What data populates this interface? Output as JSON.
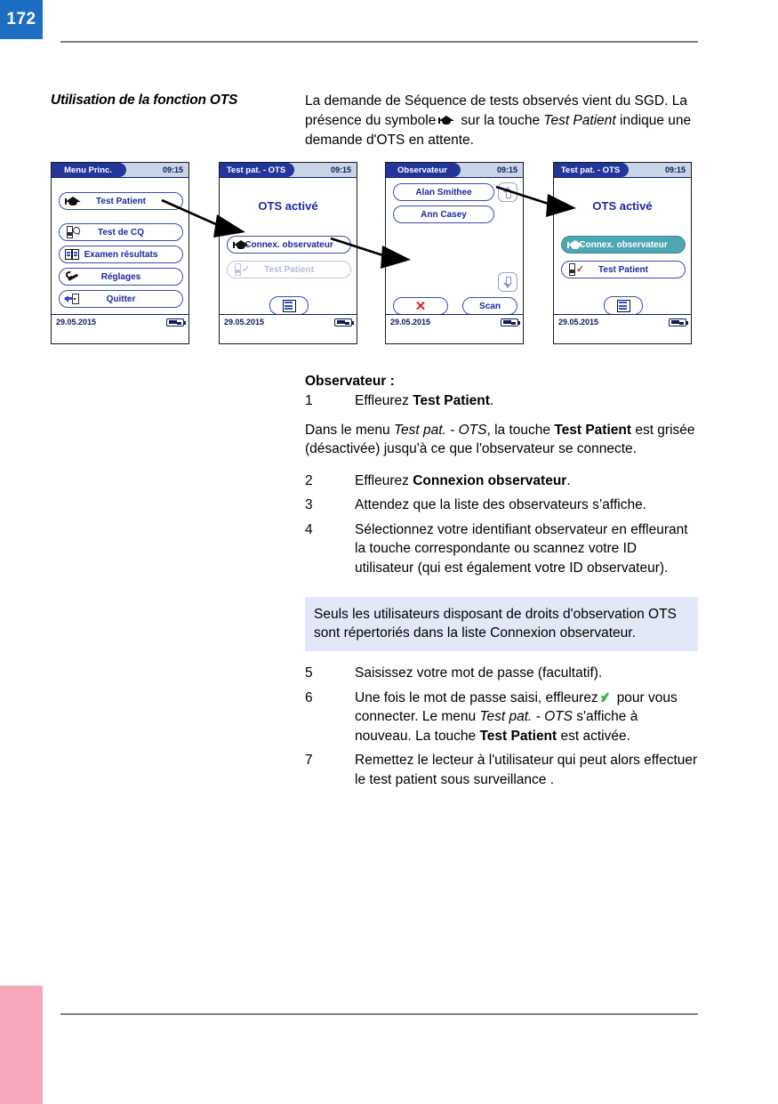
{
  "page": {
    "number": "172",
    "tab_top_color": "#1b6ec2",
    "tab_bottom_color": "#f7a8bd"
  },
  "header": {
    "section_title": "Utilisation de la fonction OTS",
    "intro_part1": "La demande de Séquence de tests observés vient du SGD. La présence du symbole",
    "intro_part2": "sur la touche",
    "intro_italic": "Test Patient",
    "intro_part3": "indique une demande d'OTS en attente."
  },
  "screens": [
    {
      "title": "Menu Princ.",
      "time": "09:15",
      "date": "29.05.2015",
      "buttons": [
        {
          "label": "Test Patient",
          "icon": "graduation-cap-icon",
          "state": "normal"
        },
        {
          "label": "Test de CQ",
          "icon": "test-strip-pipette-icon",
          "state": "normal"
        },
        {
          "label": "Examen résultats",
          "icon": "results-book-icon",
          "state": "normal"
        },
        {
          "label": "Réglages",
          "icon": "wrench-icon",
          "state": "normal"
        },
        {
          "label": "Quitter",
          "icon": "exit-door-icon",
          "state": "normal"
        }
      ]
    },
    {
      "title": "Test pat. - OTS",
      "time": "09:15",
      "date": "29.05.2015",
      "heading": "OTS activé",
      "buttons": [
        {
          "label": "Connex. observateur",
          "icon": "graduation-cap-icon",
          "state": "normal"
        },
        {
          "label": "Test Patient",
          "icon": "test-strip-check-icon",
          "state": "disabled"
        }
      ],
      "list_button_icon": "list-icon"
    },
    {
      "title": "Observateur",
      "time": "09:15",
      "date": "29.05.2015",
      "observers": [
        "Alan Smithee",
        "Ann Casey"
      ],
      "scroll_up_icon": "arrow-up-icon",
      "scroll_down_icon": "arrow-down-icon",
      "cancel_icon": "red-x-icon",
      "scan_label": "Scan"
    },
    {
      "title": "Test pat. - OTS",
      "time": "09:15",
      "date": "29.05.2015",
      "heading": "OTS activé",
      "buttons": [
        {
          "label": "Connex. observateur",
          "icon": "graduation-cap-icon",
          "state": "selected"
        },
        {
          "label": "Test Patient",
          "icon": "test-strip-check-red-icon",
          "state": "normal"
        }
      ],
      "list_button_icon": "list-icon"
    }
  ],
  "body": {
    "subheading": "Observateur :",
    "step1_num": "1",
    "step1_pre": "Effleurez ",
    "step1_bold": "Test Patient",
    "step1_post": ".",
    "para1_pre": "Dans le menu ",
    "para1_italic": "Test pat. - OTS",
    "para1_mid": ", la touche ",
    "para1_bold": "Test Patient",
    "para1_post": " est grisée (désactivée) jusqu'à ce que l'observateur se connecte.",
    "step2_num": "2",
    "step2_pre": "Effleurez ",
    "step2_bold": "Connexion observateur",
    "step2_post": ".",
    "step3_num": "3",
    "step3_text": "Attendez que la liste des observateurs s’affiche.",
    "step4_num": "4",
    "step4_text": "Sélectionnez votre identifiant observateur en effleurant la touche correspondante ou scannez votre ID utilisateur (qui est également votre ID observateur).",
    "note": "Seuls les utilisateurs disposant de droits d'observation OTS sont répertoriés dans la liste Connexion observateur.",
    "step5_num": "5",
    "step5_text": "Saisissez votre mot de passe (facultatif).",
    "step6_num": "6",
    "step6_pre": "Une fois le mot de passe saisi, effleurez",
    "step6_mid": "pour vous connecter. Le menu ",
    "step6_italic": "Test pat. - OTS",
    "step6_mid2": " s'affiche à nouveau. La touche ",
    "step6_bold": "Test Patient",
    "step6_post": " est activée.",
    "step7_num": "7",
    "step7_text": "Remettez le lecteur à l'utilisateur qui peut alors effectuer le test patient sous surveillance ."
  }
}
